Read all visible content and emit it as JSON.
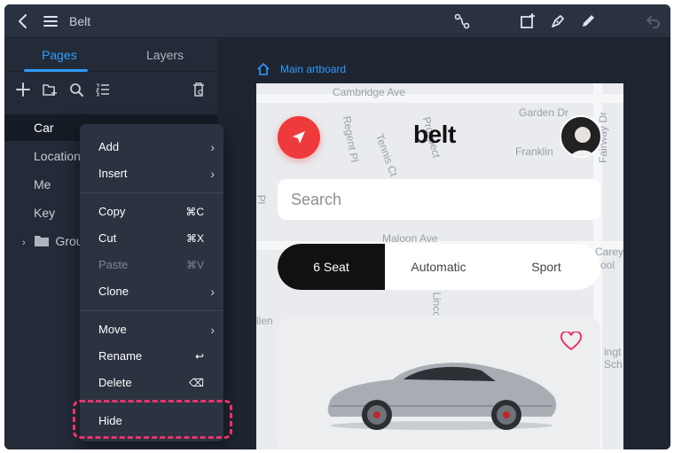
{
  "app": {
    "title": "Belt"
  },
  "sidebar": {
    "tabs": [
      {
        "label": "Pages"
      },
      {
        "label": "Layers"
      }
    ],
    "pages": [
      {
        "label": "Car"
      },
      {
        "label": "Location"
      },
      {
        "label": "Me"
      },
      {
        "label": "Key"
      },
      {
        "label": "Group"
      }
    ]
  },
  "canvas": {
    "artboard_label": "Main artboard",
    "map_streets": [
      "Cambridge Ave",
      "Garden Dr",
      "Regent Pl",
      "Tennis Ct",
      "Franklin",
      "Fairway Dr",
      "Maloon Ave",
      "Carey",
      "ool",
      "Lincol",
      "llen",
      "Pl",
      "ingt",
      "Sch",
      "Prospect"
    ],
    "app_logo": "belt",
    "search_placeholder": "Search",
    "segments": [
      {
        "label": "6 Seat"
      },
      {
        "label": "Automatic"
      },
      {
        "label": "Sport"
      }
    ]
  },
  "context_menu": {
    "items": [
      {
        "label": "Add",
        "submenu": true
      },
      {
        "label": "Insert",
        "submenu": true
      },
      {
        "label": "Copy",
        "shortcut": "⌘C"
      },
      {
        "label": "Cut",
        "shortcut": "⌘X"
      },
      {
        "label": "Paste",
        "shortcut": "⌘V",
        "disabled": true
      },
      {
        "label": "Clone",
        "submenu": true
      },
      {
        "label": "Move",
        "submenu": true
      },
      {
        "label": "Rename",
        "shortcut": "↩"
      },
      {
        "label": "Delete",
        "shortcut": "⌫"
      },
      {
        "label": "Hide"
      }
    ]
  },
  "colors": {
    "accent": "#2f9cff",
    "highlight": "#e8336b",
    "nav_red": "#ee3a3a"
  }
}
